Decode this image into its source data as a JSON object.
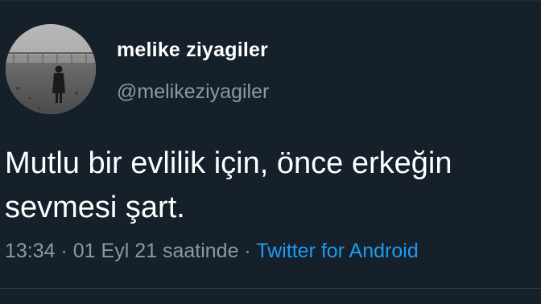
{
  "user": {
    "display_name": "melike ziyagiler",
    "handle": "@melikeziyagiler"
  },
  "tweet": {
    "line1": "Mutlu bir evlilik için, önce erkeğin",
    "line2": "sevmesi şart."
  },
  "meta": {
    "time": "13:34",
    "separator1": " · ",
    "date_text": "01 Eyl 21 saatinde",
    "separator2": " · ",
    "source": "Twitter for Android"
  },
  "colors": {
    "background": "#15202b",
    "text": "#ffffff",
    "secondary": "#8b98a5",
    "accent": "#1d9bf0"
  }
}
